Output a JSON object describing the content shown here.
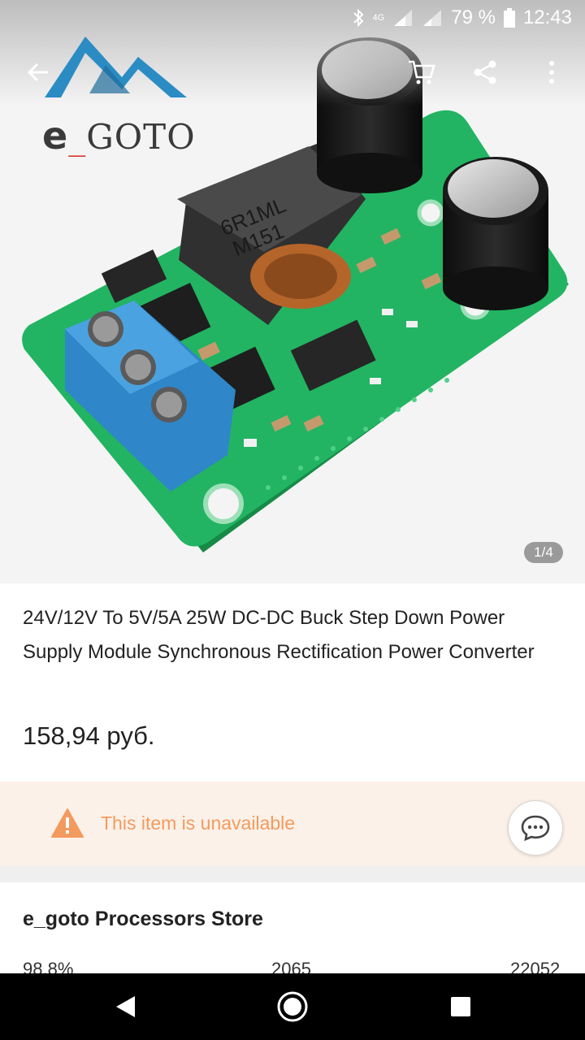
{
  "status_bar": {
    "network": "4G",
    "battery": "79 %",
    "time": "12:43"
  },
  "logo": {
    "text_e": "e",
    "text_underscore": "_",
    "text_rest": "GOTO"
  },
  "gallery": {
    "pager": "1/4"
  },
  "product": {
    "title": "24V/12V To 5V/5A 25W DC-DC Buck Step Down Power Supply Module Synchronous Rectification Power Converter",
    "price": "158,94 руб."
  },
  "availability": {
    "message": "This item is unavailable"
  },
  "store": {
    "name": "e_goto Processors Store",
    "stats": [
      "98.8%",
      "2065",
      "22052"
    ]
  },
  "icons": {
    "back": "arrow-left-icon",
    "cart": "cart-icon",
    "share": "share-icon",
    "more": "more-vertical-icon",
    "chat": "chat-bubble-icon",
    "warning": "warning-triangle-icon"
  },
  "colors": {
    "warning": "#f39a5f",
    "banner_bg": "#fcf1e8",
    "pcb_green": "#22b462",
    "terminal_blue": "#2f86c9"
  }
}
